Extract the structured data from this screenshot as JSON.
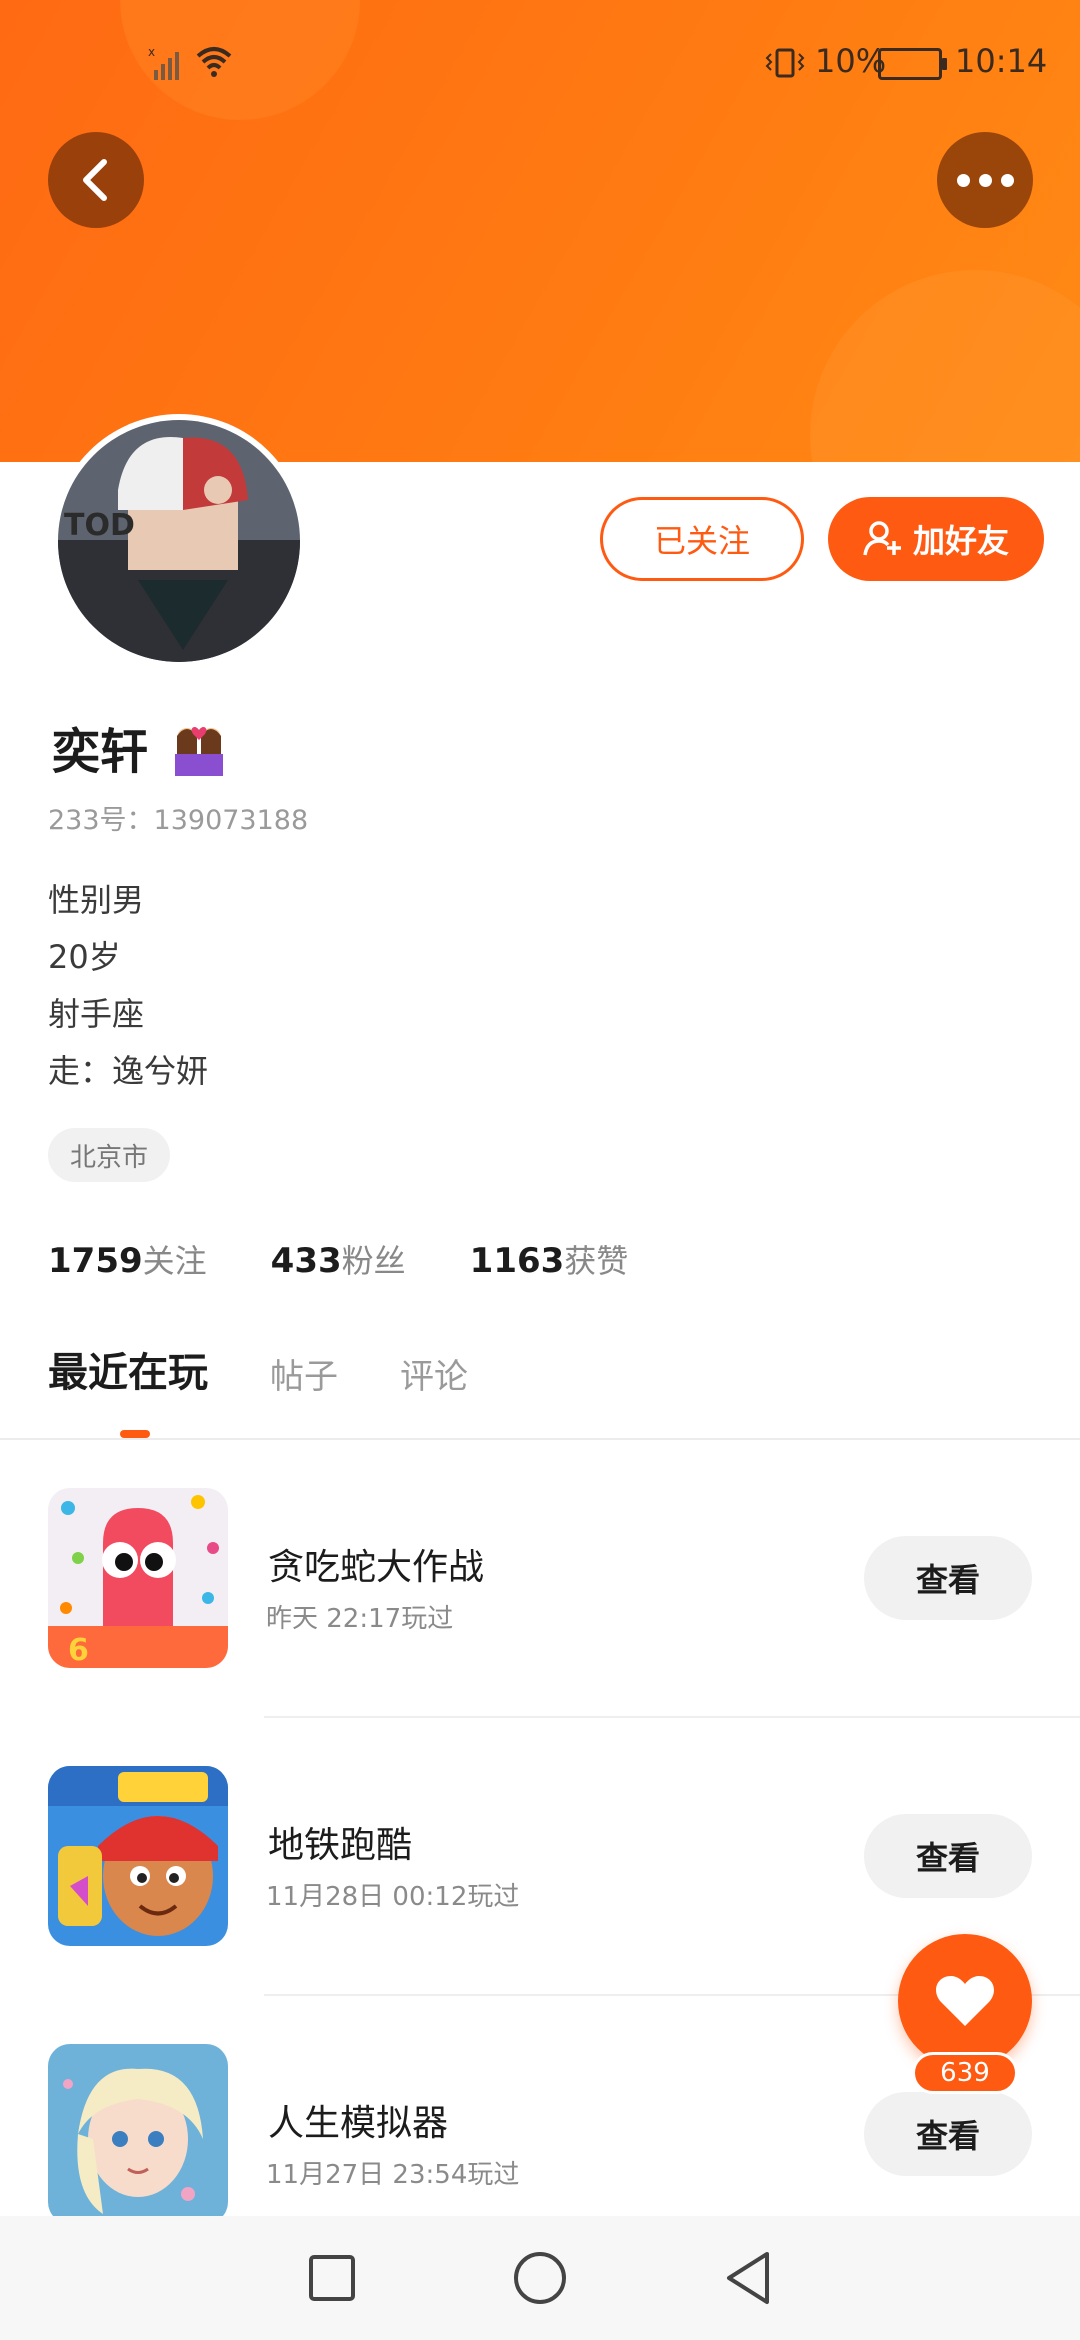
{
  "status_bar": {
    "battery_percent": "10%",
    "time": "10:14"
  },
  "profile": {
    "username": "奕轩",
    "id_line": "233号：139073188",
    "bio_lines": [
      "性别男",
      "20岁",
      "射手座",
      "走：逸兮妍"
    ],
    "location": "北京市",
    "followed_label": "已关注",
    "add_friend_label": "加好友"
  },
  "stats": [
    {
      "num": "1759",
      "label": "关注"
    },
    {
      "num": "433",
      "label": "粉丝"
    },
    {
      "num": "1163",
      "label": "获赞"
    }
  ],
  "tabs": [
    {
      "label": "最近在玩",
      "active": true
    },
    {
      "label": "帖子",
      "active": false
    },
    {
      "label": "评论",
      "active": false
    }
  ],
  "games": [
    {
      "name": "贪吃蛇大作战",
      "time": "昨天 22:17玩过",
      "view_label": "查看",
      "icon": "snake-game-icon"
    },
    {
      "name": "地铁跑酷",
      "time": "11月28日 00:12玩过",
      "view_label": "查看",
      "icon": "subway-surfers-icon"
    },
    {
      "name": "人生模拟器",
      "time": "11月27日 23:54玩过",
      "view_label": "查看",
      "icon": "life-simulator-icon"
    }
  ],
  "like_fab": {
    "count": "639"
  },
  "colors": {
    "accent": "#ff5a12",
    "header": "#ff7a12"
  }
}
